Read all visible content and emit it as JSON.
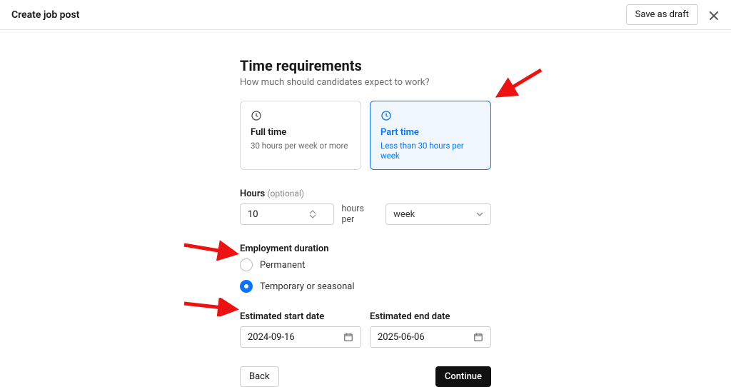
{
  "header": {
    "title": "Create job post",
    "save_draft": "Save as draft"
  },
  "page": {
    "heading": "Time requirements",
    "subheading": "How much should candidates expect to work?"
  },
  "time_type": {
    "fulltime": {
      "title": "Full time",
      "sub": "30 hours per week or more"
    },
    "parttime": {
      "title": "Part time",
      "sub": "Less than 30 hours per week"
    }
  },
  "hours": {
    "label": "Hours",
    "optional": "(optional)",
    "value": "10",
    "per_text": "hours per",
    "unit": "week"
  },
  "duration": {
    "label": "Employment duration",
    "permanent": "Permanent",
    "temporary": "Temporary or seasonal"
  },
  "dates": {
    "start_label": "Estimated start date",
    "start_value": "2024-09-16",
    "end_label": "Estimated end date",
    "end_value": "2025-06-06"
  },
  "footer": {
    "back": "Back",
    "continue": "Continue"
  }
}
